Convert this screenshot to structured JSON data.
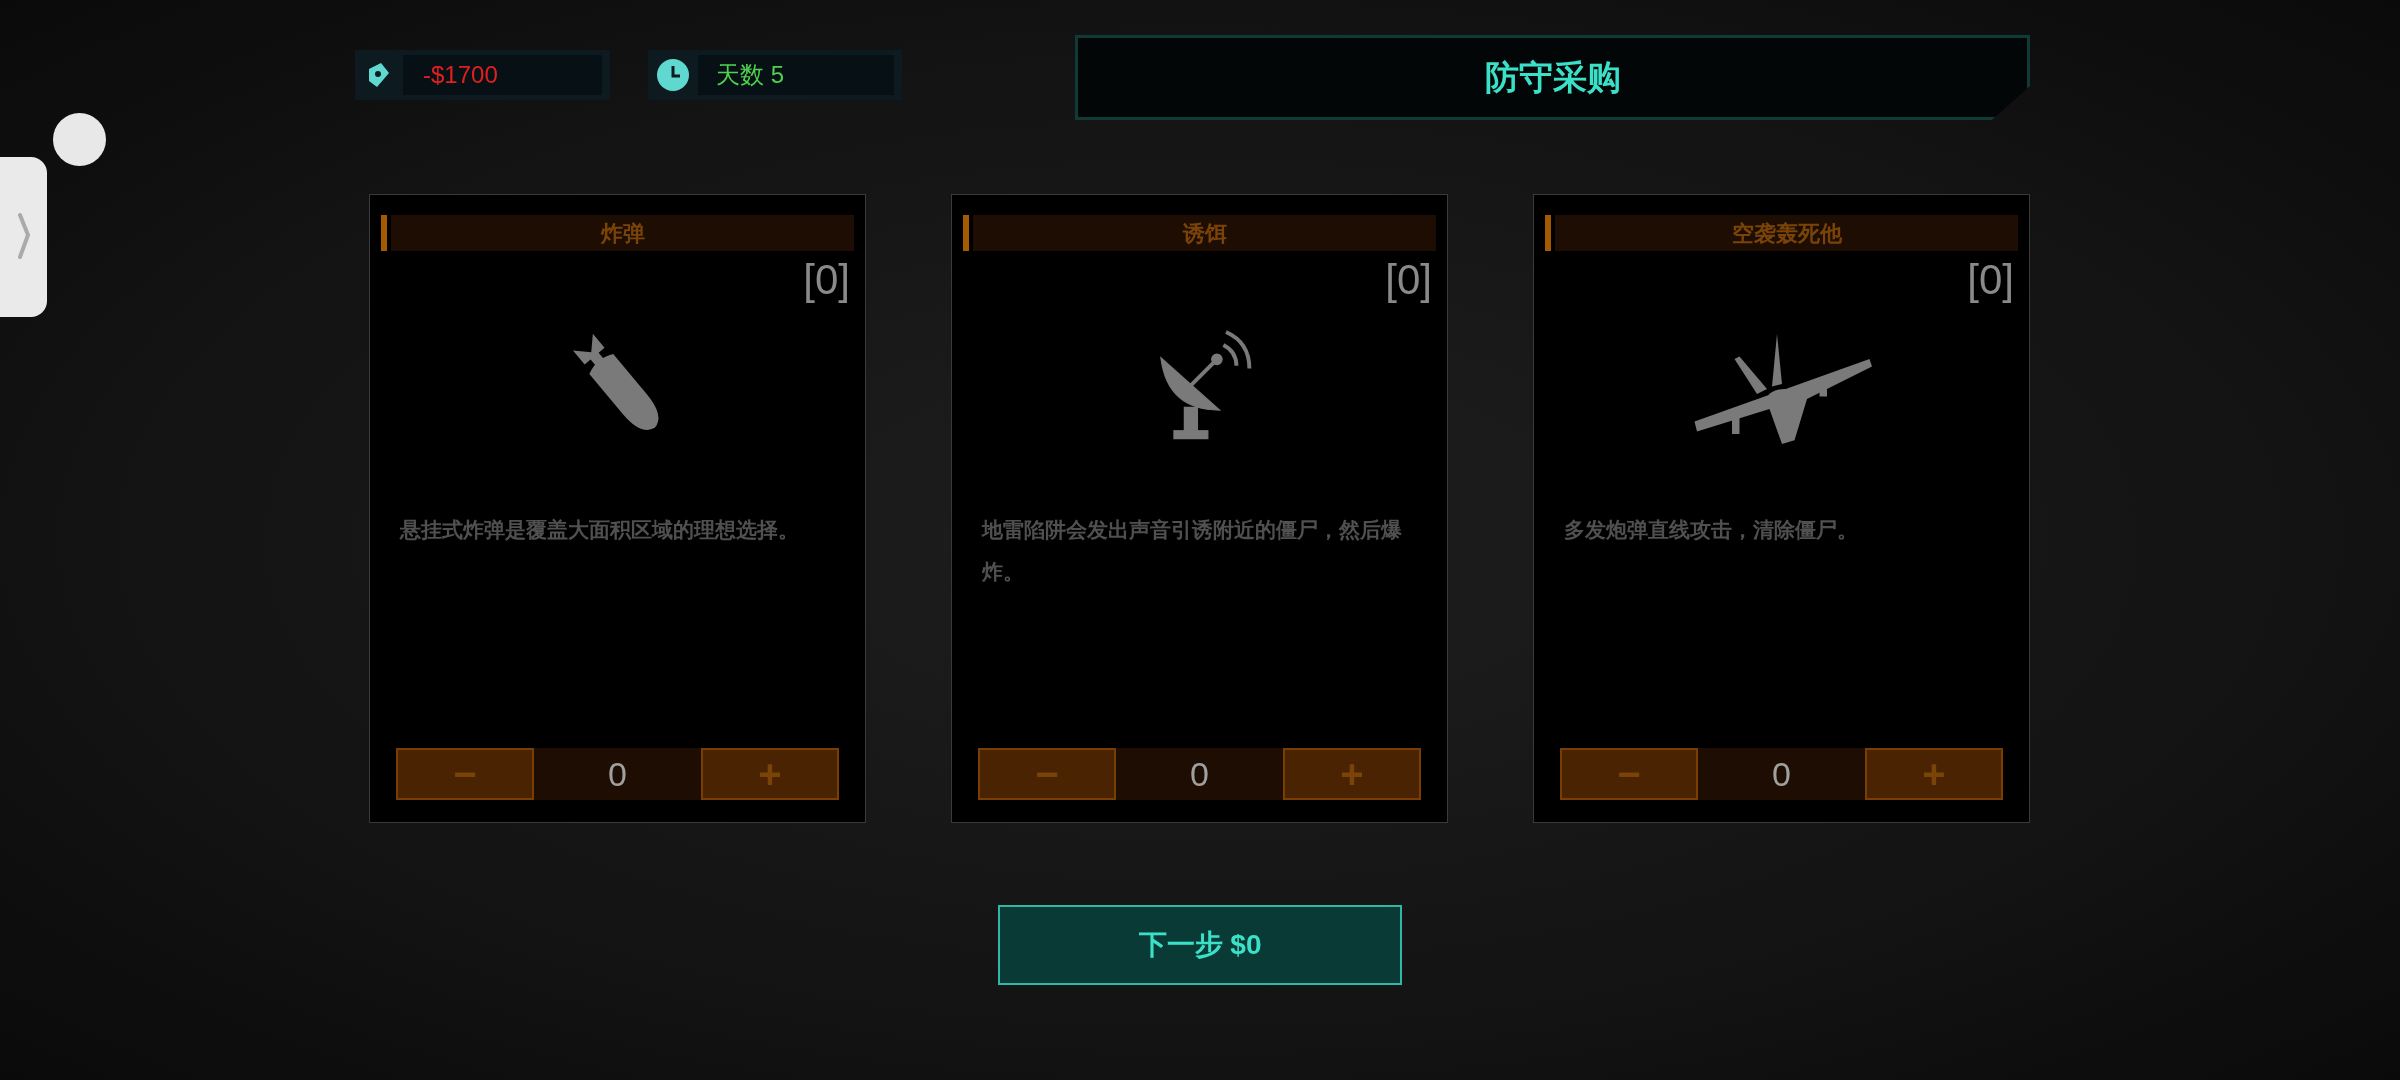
{
  "status": {
    "money": "-$1700",
    "day": "天数 5"
  },
  "title": "防守采购",
  "cards": [
    {
      "kind": "bomb",
      "title": "炸弹",
      "count": "[0]",
      "description": "悬挂式炸弹是覆盖大面积区域的理想选择。",
      "minus": "−",
      "quantity": "0",
      "plus": "+"
    },
    {
      "kind": "dish",
      "title": "诱饵",
      "count": "[0]",
      "description": "地雷陷阱会发出声音引诱附近的僵尸，然后爆炸。",
      "minus": "−",
      "quantity": "0",
      "plus": "+"
    },
    {
      "kind": "jet",
      "title": "空袭轰死他",
      "count": "[0]",
      "description": "多发炮弹直线攻击，清除僵尸。",
      "minus": "−",
      "quantity": "0",
      "plus": "+"
    }
  ],
  "next_button": "下一步 $0"
}
